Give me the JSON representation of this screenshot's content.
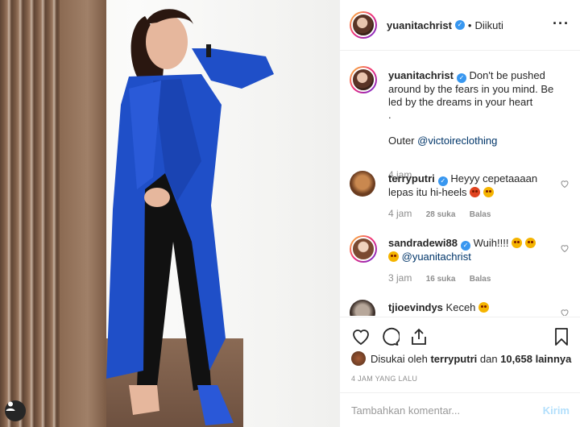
{
  "post": {
    "author": "yuanitachrist",
    "follow_status": "Diikuti",
    "caption": "Don't be pushed around by the fears in you mind. Be led by the dreams in your heart",
    "caption_dot": ".",
    "caption_credit_prefix": "Outer",
    "caption_credit_tag": "@victoireclothing",
    "caption_time": "4 jam"
  },
  "comments": [
    {
      "user": "terryputri",
      "text": "Heyyy cepetaaaan lepas itu hi-heels",
      "time": "4 jam",
      "likes": "28 suka",
      "reply": "Balas"
    },
    {
      "user": "sandradewi88",
      "text": "Wuih!!!!",
      "mention": "@yuanitachrist",
      "time": "3 jam",
      "likes": "16 suka",
      "reply": "Balas"
    },
    {
      "user": "tjioevindys",
      "text": "Keceh"
    }
  ],
  "liked_by": {
    "prefix": "Disukai oleh",
    "user": "terryputri",
    "and": "dan",
    "count": "10,658 lainnya"
  },
  "time_ago": "4 JAM YANG LALU",
  "composer": {
    "placeholder": "Tambahkan komentar...",
    "post_label": "Kirim"
  },
  "colors": {
    "verified": "#3897f0",
    "link": "#003569",
    "post_disabled": "#b2dffc",
    "coat": "#1f4fc8"
  },
  "icons": [
    "verified-badge-icon",
    "more-options-icon",
    "heart-icon",
    "comment-icon",
    "share-icon",
    "bookmark-icon",
    "user-tag-icon"
  ]
}
